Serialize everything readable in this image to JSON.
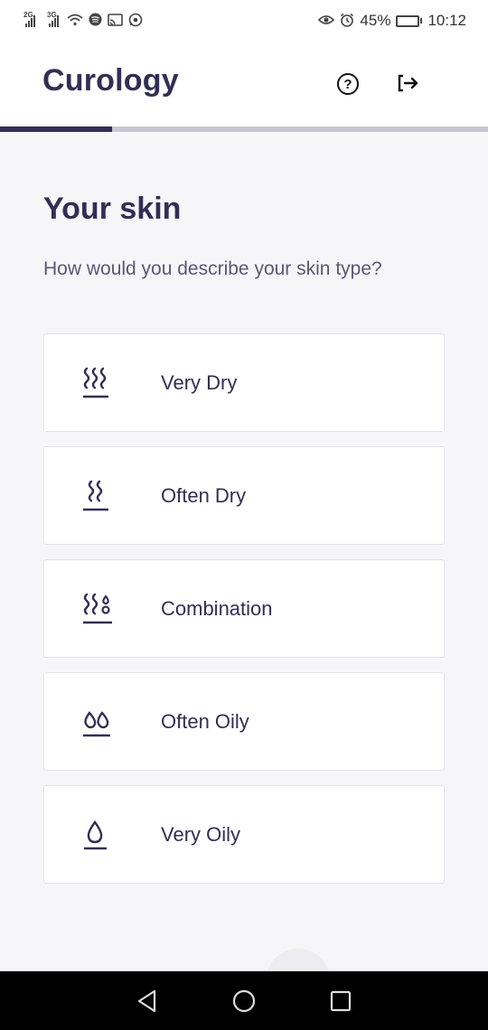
{
  "status_bar": {
    "net1": "2G",
    "net2": "3G",
    "battery_percent": "45%",
    "battery_level": 0.45,
    "time": "10:12",
    "icons": [
      "wifi-icon",
      "spotify-icon",
      "cast-icon",
      "whatsapp-icon",
      "eye-icon",
      "alarm-icon",
      "battery-icon"
    ]
  },
  "header": {
    "logo": "Curology",
    "help_icon": "question-circle-icon",
    "logout_icon": "logout-arrow-icon"
  },
  "progress": {
    "fraction": 0.23
  },
  "main": {
    "title": "Your skin",
    "question": "How would you describe your skin type?",
    "options": [
      {
        "label": "Very Dry",
        "icon": "steam-three-icon"
      },
      {
        "label": "Often Dry",
        "icon": "steam-two-icon"
      },
      {
        "label": "Combination",
        "icon": "steam-drops-icon"
      },
      {
        "label": "Often Oily",
        "icon": "two-drops-icon"
      },
      {
        "label": "Very Oily",
        "icon": "drop-icon"
      }
    ]
  },
  "colors": {
    "brand": "#332e54",
    "background": "#f6f6f9",
    "progress_track": "#c9c6d6"
  },
  "nav": {
    "back_icon": "back-triangle-icon",
    "home_icon": "home-circle-icon",
    "recents_icon": "recents-square-icon"
  }
}
